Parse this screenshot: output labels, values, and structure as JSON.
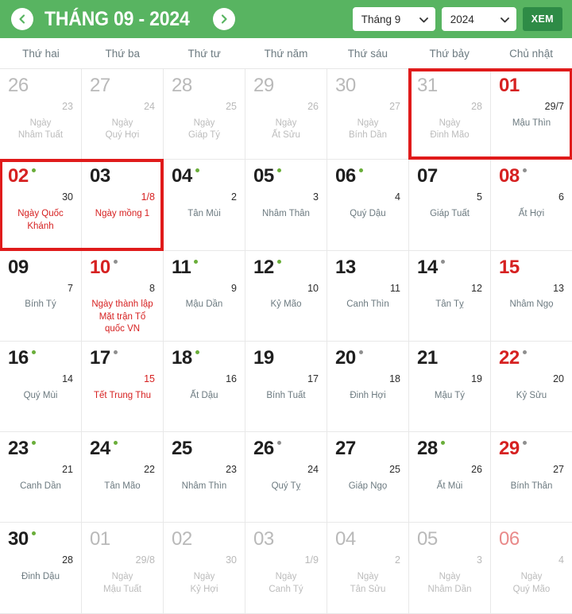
{
  "header": {
    "prev_label": "chevron-left",
    "next_label": "chevron-right",
    "title": "THÁNG 09 - 2024",
    "month_select": {
      "value": "Tháng 9"
    },
    "year_select": {
      "value": "2024"
    },
    "view_button": "XEM"
  },
  "weekdays": [
    "Thứ hai",
    "Thứ ba",
    "Thứ tư",
    "Thứ năm",
    "Thứ sáu",
    "Thứ bảy",
    "Chủ nhật"
  ],
  "colors": {
    "header_green": "#58b461",
    "button_green": "#2e8b46",
    "red": "#d62121",
    "highlight_red": "#e01b1b",
    "dot_green": "#6aae3a",
    "muted": "#b9b9b9"
  },
  "highlights": [
    {
      "label": "highlight-aug31-sep01",
      "row": 0,
      "col_start": 5,
      "col_span": 2
    },
    {
      "label": "highlight-sep02-sep03",
      "row": 1,
      "col_start": 0,
      "col_span": 2
    }
  ],
  "cells": [
    {
      "day": "26",
      "lunar": "23",
      "event": "Ngày\nNhâm Tuất",
      "out": true,
      "red": false,
      "dot": "none",
      "lunar_red": false,
      "event_red": false
    },
    {
      "day": "27",
      "lunar": "24",
      "event": "Ngày\nQuý Hợi",
      "out": true,
      "red": false,
      "dot": "none",
      "lunar_red": false,
      "event_red": false
    },
    {
      "day": "28",
      "lunar": "25",
      "event": "Ngày\nGiáp Tý",
      "out": true,
      "red": false,
      "dot": "none",
      "lunar_red": false,
      "event_red": false
    },
    {
      "day": "29",
      "lunar": "26",
      "event": "Ngày\nẤt Sửu",
      "out": true,
      "red": false,
      "dot": "none",
      "lunar_red": false,
      "event_red": false
    },
    {
      "day": "30",
      "lunar": "27",
      "event": "Ngày\nBính Dần",
      "out": true,
      "red": false,
      "dot": "none",
      "lunar_red": false,
      "event_red": false
    },
    {
      "day": "31",
      "lunar": "28",
      "event": "Ngày\nĐinh Mão",
      "out": true,
      "red": false,
      "dot": "none",
      "lunar_red": false,
      "event_red": false
    },
    {
      "day": "01",
      "lunar": "29/7",
      "event": "Mậu Thìn",
      "out": false,
      "red": true,
      "dot": "none",
      "lunar_red": false,
      "event_red": false
    },
    {
      "day": "02",
      "lunar": "30",
      "event": "Ngày Quốc\nKhánh",
      "out": false,
      "red": true,
      "dot": "green",
      "lunar_red": false,
      "event_red": true
    },
    {
      "day": "03",
      "lunar": "1/8",
      "event": "Ngày mồng 1",
      "out": false,
      "red": false,
      "dot": "none",
      "lunar_red": true,
      "event_red": true
    },
    {
      "day": "04",
      "lunar": "2",
      "event": "Tân Mùi",
      "out": false,
      "red": false,
      "dot": "green",
      "lunar_red": false,
      "event_red": false
    },
    {
      "day": "05",
      "lunar": "3",
      "event": "Nhâm Thân",
      "out": false,
      "red": false,
      "dot": "green",
      "lunar_red": false,
      "event_red": false
    },
    {
      "day": "06",
      "lunar": "4",
      "event": "Quý Dậu",
      "out": false,
      "red": false,
      "dot": "green",
      "lunar_red": false,
      "event_red": false
    },
    {
      "day": "07",
      "lunar": "5",
      "event": "Giáp Tuất",
      "out": false,
      "red": false,
      "dot": "none",
      "lunar_red": false,
      "event_red": false
    },
    {
      "day": "08",
      "lunar": "6",
      "event": "Ất Hợi",
      "out": false,
      "red": true,
      "dot": "grey",
      "lunar_red": false,
      "event_red": false
    },
    {
      "day": "09",
      "lunar": "7",
      "event": "Bính Tý",
      "out": false,
      "red": false,
      "dot": "none",
      "lunar_red": false,
      "event_red": false
    },
    {
      "day": "10",
      "lunar": "8",
      "event": "Ngày thành lập\nMặt trận Tổ\nquốc VN",
      "out": false,
      "red": true,
      "dot": "grey",
      "lunar_red": false,
      "event_red": true
    },
    {
      "day": "11",
      "lunar": "9",
      "event": "Mậu Dần",
      "out": false,
      "red": false,
      "dot": "green",
      "lunar_red": false,
      "event_red": false
    },
    {
      "day": "12",
      "lunar": "10",
      "event": "Kỷ Mão",
      "out": false,
      "red": false,
      "dot": "green",
      "lunar_red": false,
      "event_red": false
    },
    {
      "day": "13",
      "lunar": "11",
      "event": "Canh Thìn",
      "out": false,
      "red": false,
      "dot": "none",
      "lunar_red": false,
      "event_red": false
    },
    {
      "day": "14",
      "lunar": "12",
      "event": "Tân Tỵ",
      "out": false,
      "red": false,
      "dot": "grey",
      "lunar_red": false,
      "event_red": false
    },
    {
      "day": "15",
      "lunar": "13",
      "event": "Nhâm Ngọ",
      "out": false,
      "red": true,
      "dot": "none",
      "lunar_red": false,
      "event_red": false
    },
    {
      "day": "16",
      "lunar": "14",
      "event": "Quý Mùi",
      "out": false,
      "red": false,
      "dot": "green",
      "lunar_red": false,
      "event_red": false
    },
    {
      "day": "17",
      "lunar": "15",
      "event": "Tết Trung Thu",
      "out": false,
      "red": false,
      "dot": "grey",
      "lunar_red": true,
      "event_red": true
    },
    {
      "day": "18",
      "lunar": "16",
      "event": "Ất Dậu",
      "out": false,
      "red": false,
      "dot": "green",
      "lunar_red": false,
      "event_red": false
    },
    {
      "day": "19",
      "lunar": "17",
      "event": "Bính Tuất",
      "out": false,
      "red": false,
      "dot": "none",
      "lunar_red": false,
      "event_red": false
    },
    {
      "day": "20",
      "lunar": "18",
      "event": "Đinh Hợi",
      "out": false,
      "red": false,
      "dot": "grey",
      "lunar_red": false,
      "event_red": false
    },
    {
      "day": "21",
      "lunar": "19",
      "event": "Mậu Tý",
      "out": false,
      "red": false,
      "dot": "none",
      "lunar_red": false,
      "event_red": false
    },
    {
      "day": "22",
      "lunar": "20",
      "event": "Kỷ Sửu",
      "out": false,
      "red": true,
      "dot": "grey",
      "lunar_red": false,
      "event_red": false
    },
    {
      "day": "23",
      "lunar": "21",
      "event": "Canh Dần",
      "out": false,
      "red": false,
      "dot": "green",
      "lunar_red": false,
      "event_red": false
    },
    {
      "day": "24",
      "lunar": "22",
      "event": "Tân Mão",
      "out": false,
      "red": false,
      "dot": "green",
      "lunar_red": false,
      "event_red": false
    },
    {
      "day": "25",
      "lunar": "23",
      "event": "Nhâm Thìn",
      "out": false,
      "red": false,
      "dot": "none",
      "lunar_red": false,
      "event_red": false
    },
    {
      "day": "26",
      "lunar": "24",
      "event": "Quý Tỵ",
      "out": false,
      "red": false,
      "dot": "grey",
      "lunar_red": false,
      "event_red": false
    },
    {
      "day": "27",
      "lunar": "25",
      "event": "Giáp Ngọ",
      "out": false,
      "red": false,
      "dot": "none",
      "lunar_red": false,
      "event_red": false
    },
    {
      "day": "28",
      "lunar": "26",
      "event": "Ất Mùi",
      "out": false,
      "red": false,
      "dot": "green",
      "lunar_red": false,
      "event_red": false
    },
    {
      "day": "29",
      "lunar": "27",
      "event": "Bính Thân",
      "out": false,
      "red": true,
      "dot": "grey",
      "lunar_red": false,
      "event_red": false
    },
    {
      "day": "30",
      "lunar": "28",
      "event": "Đinh Dậu",
      "out": false,
      "red": false,
      "dot": "green",
      "lunar_red": false,
      "event_red": false
    },
    {
      "day": "01",
      "lunar": "29/8",
      "event": "Ngày\nMậu Tuất",
      "out": true,
      "red": false,
      "dot": "none",
      "lunar_red": false,
      "event_red": false
    },
    {
      "day": "02",
      "lunar": "30",
      "event": "Ngày\nKỷ Hợi",
      "out": true,
      "red": false,
      "dot": "none",
      "lunar_red": false,
      "event_red": false
    },
    {
      "day": "03",
      "lunar": "1/9",
      "event": "Ngày\nCanh Tý",
      "out": true,
      "red": false,
      "dot": "none",
      "lunar_red": false,
      "event_red": false
    },
    {
      "day": "04",
      "lunar": "2",
      "event": "Ngày\nTân Sửu",
      "out": true,
      "red": false,
      "dot": "none",
      "lunar_red": false,
      "event_red": false
    },
    {
      "day": "05",
      "lunar": "3",
      "event": "Ngày\nNhâm Dần",
      "out": true,
      "red": false,
      "dot": "none",
      "lunar_red": false,
      "event_red": false
    },
    {
      "day": "06",
      "lunar": "4",
      "event": "Ngày\nQuý Mão",
      "out": true,
      "red": true,
      "dot": "none",
      "lunar_red": false,
      "event_red": false
    }
  ]
}
